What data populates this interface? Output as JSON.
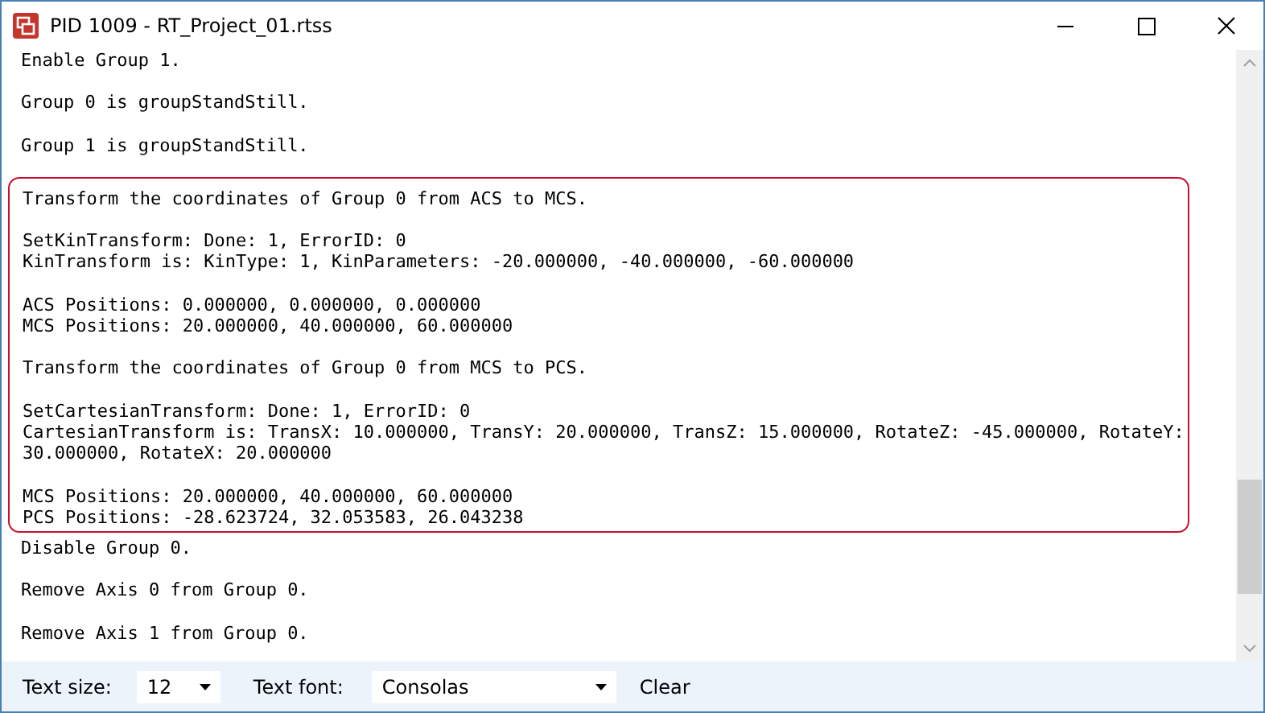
{
  "window": {
    "title": "PID 1009 - RT_Project_01.rtss"
  },
  "log_blocks": [
    {
      "highlighted": false,
      "paragraphs": [
        [
          "Enable Group 1."
        ],
        [
          "Group 0 is groupStandStill."
        ],
        [
          "Group 1 is groupStandStill."
        ]
      ]
    },
    {
      "highlighted": true,
      "paragraphs": [
        [
          "Transform the coordinates of Group 0 from ACS to MCS."
        ],
        [
          "SetKinTransform: Done: 1, ErrorID: 0",
          "KinTransform is: KinType: 1, KinParameters: -20.000000, -40.000000, -60.000000"
        ],
        [
          "ACS Positions: 0.000000, 0.000000, 0.000000",
          "MCS Positions: 20.000000, 40.000000, 60.000000"
        ],
        [
          "Transform the coordinates of Group 0 from MCS to PCS."
        ],
        [
          "SetCartesianTransform: Done: 1, ErrorID: 0",
          "CartesianTransform is: TransX: 10.000000, TransY: 20.000000, TransZ: 15.000000, RotateZ: -45.000000, RotateY: 30.000000, RotateX: 20.000000"
        ],
        [
          "MCS Positions: 20.000000, 40.000000, 60.000000",
          "PCS Positions: -28.623724, 32.053583, 26.043238"
        ]
      ]
    },
    {
      "highlighted": false,
      "paragraphs": [
        [
          "Disable Group 0."
        ],
        [
          "Remove Axis 0 from Group 0."
        ],
        [
          "Remove Axis 1 from Group 0."
        ]
      ]
    }
  ],
  "bottom_bar": {
    "text_size_label": "Text size:",
    "text_size": "12",
    "text_font_label": "Text font:",
    "text_font": "Consolas",
    "clear_button": "Clear"
  }
}
